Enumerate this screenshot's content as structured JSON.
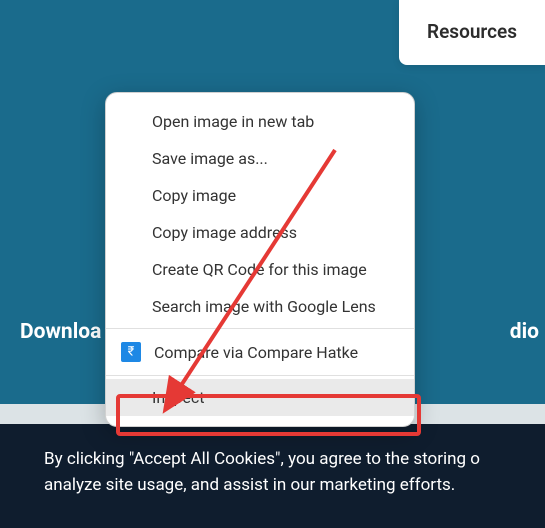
{
  "header": {
    "resources_label": "Resources"
  },
  "page": {
    "download_fragment_left": "Downloa",
    "download_fragment_right": "dio"
  },
  "context_menu": {
    "items": [
      {
        "label": "Open image in new tab",
        "hasIcon": false
      },
      {
        "label": "Save image as...",
        "hasIcon": false
      },
      {
        "label": "Copy image",
        "hasIcon": false
      },
      {
        "label": "Copy image address",
        "hasIcon": false
      },
      {
        "label": "Create QR Code for this image",
        "hasIcon": false
      },
      {
        "label": "Search image with Google Lens",
        "hasIcon": false
      }
    ],
    "extension_item": {
      "label": "Compare via Compare Hatke",
      "icon": "compare-hatke-icon"
    },
    "inspect_item": {
      "label": "Inspect"
    }
  },
  "cookie_banner": {
    "line1": "By clicking \"Accept All Cookies\", you agree to the storing o",
    "line2": "analyze site usage, and assist in our marketing efforts."
  },
  "annotation": {
    "highlight_color": "#e53935"
  }
}
